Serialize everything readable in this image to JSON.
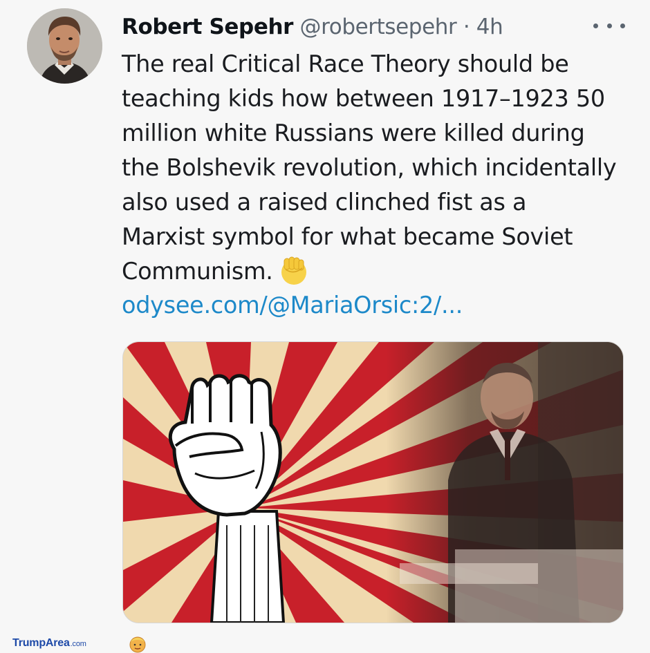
{
  "tweet": {
    "author_name": "Robert Sepehr",
    "author_handle": "@robertsepehr",
    "separator": "·",
    "timestamp": "4h",
    "lines": [
      "The real Critical Race Theory should be",
      "teaching kids how between 1917–1923 50",
      "million white Russians were killed during",
      "the Bolshevik revolution, which incidentally",
      "also used a raised clinched fist as a",
      "Marxist symbol for what became Soviet",
      "Communism."
    ],
    "emoji": "raised-fist-emoji",
    "link_text": "odysee.com/@MariaOrsic:2/...",
    "more_icon": "more-options-icon",
    "media_alt": "raised-fist-sunburst-and-lenin-photo"
  },
  "watermark": {
    "brand": "TrumpArea",
    "suffix": ".com",
    "mascot_icon": "trump-face-icon"
  },
  "colors": {
    "link": "#1d89c9",
    "muted": "#5b6570",
    "sunburst_red": "#c8202a",
    "sunburst_cream": "#f2dcb2",
    "watermark_blue": "#1e4aa8"
  }
}
